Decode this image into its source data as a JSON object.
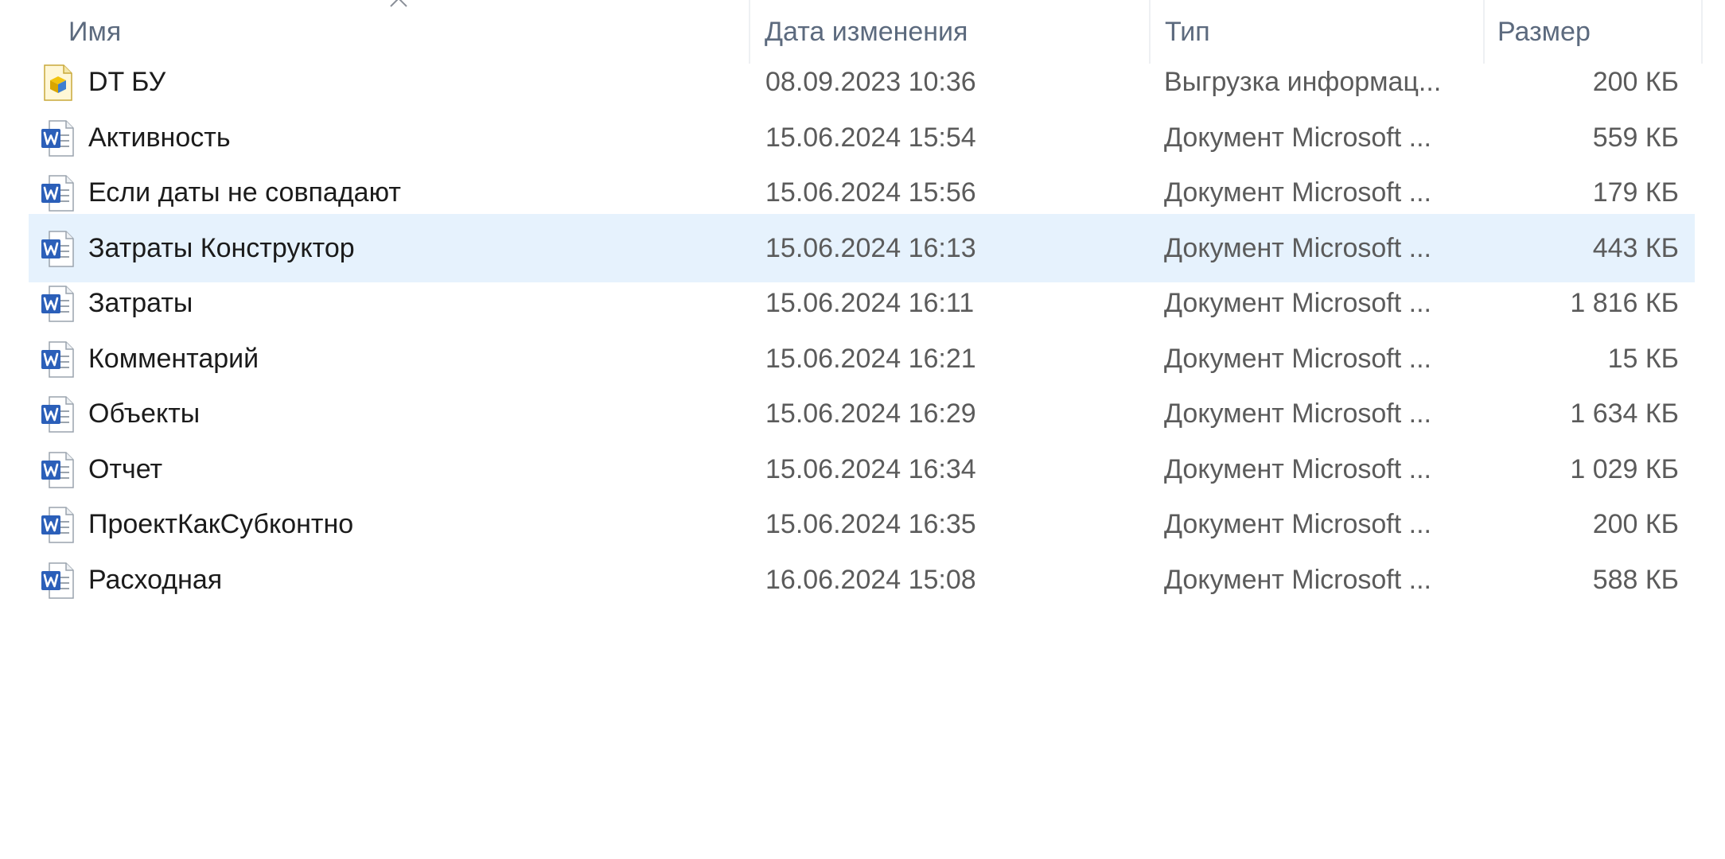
{
  "columns": {
    "name": "Имя",
    "date": "Дата изменения",
    "type": "Тип",
    "size": "Размер"
  },
  "files": [
    {
      "name": "DT БУ",
      "date": "08.09.2023 10:36",
      "type": "Выгрузка информац...",
      "size": "200 КБ",
      "icon": "1c-data-file-icon",
      "selected": false
    },
    {
      "name": "Активность",
      "date": "15.06.2024 15:54",
      "type": "Документ Microsoft ...",
      "size": "559 КБ",
      "icon": "word-document-icon",
      "selected": false
    },
    {
      "name": "Если даты не совпадают",
      "date": "15.06.2024 15:56",
      "type": "Документ Microsoft ...",
      "size": "179 КБ",
      "icon": "word-document-icon",
      "selected": false
    },
    {
      "name": "Затраты Конструктор",
      "date": "15.06.2024 16:13",
      "type": "Документ Microsoft ...",
      "size": "443 КБ",
      "icon": "word-document-icon",
      "selected": true
    },
    {
      "name": "Затраты",
      "date": "15.06.2024 16:11",
      "type": "Документ Microsoft ...",
      "size": "1 816 КБ",
      "icon": "word-document-icon",
      "selected": false
    },
    {
      "name": "Комментарий",
      "date": "15.06.2024 16:21",
      "type": "Документ Microsoft ...",
      "size": "15 КБ",
      "icon": "word-document-icon",
      "selected": false
    },
    {
      "name": "Объекты",
      "date": "15.06.2024 16:29",
      "type": "Документ Microsoft ...",
      "size": "1 634 КБ",
      "icon": "word-document-icon",
      "selected": false
    },
    {
      "name": "Отчет",
      "date": "15.06.2024 16:34",
      "type": "Документ Microsoft ...",
      "size": "1 029 КБ",
      "icon": "word-document-icon",
      "selected": false
    },
    {
      "name": "ПроектКакСубконтно",
      "date": "15.06.2024 16:35",
      "type": "Документ Microsoft ...",
      "size": "200 КБ",
      "icon": "word-document-icon",
      "selected": false
    },
    {
      "name": "Расходная",
      "date": "16.06.2024 15:08",
      "type": "Документ Microsoft ...",
      "size": "588 КБ",
      "icon": "word-document-icon",
      "selected": false
    }
  ],
  "colors": {
    "selection": "#e6f2fd",
    "word_blue": "#2b5fb9",
    "header_text": "#5c6a7e"
  }
}
